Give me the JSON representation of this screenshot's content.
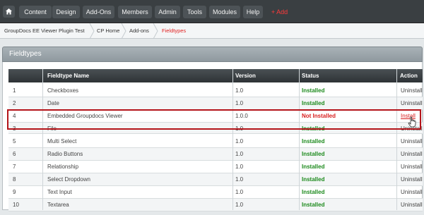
{
  "nav": {
    "items": [
      "Content",
      "Design",
      "Add-Ons",
      "Members",
      "Admin",
      "Tools",
      "Modules",
      "Help"
    ],
    "add_label": "+ Add"
  },
  "breadcrumb": [
    "GroupDocs EE Viewer Plugin Test",
    "CP Home",
    "Add-ons",
    "Fieldtypes"
  ],
  "panel": {
    "title": "Fieldtypes"
  },
  "table": {
    "headers": [
      "Fieldtype Name",
      "Version",
      "Status",
      "Action"
    ],
    "rows": [
      {
        "num": "1",
        "name": "Checkboxes",
        "version": "1.0",
        "status": "Installed",
        "action": "Uninstall"
      },
      {
        "num": "2",
        "name": "Date",
        "version": "1.0",
        "status": "Installed",
        "action": "Uninstall"
      },
      {
        "num": "4",
        "name": "Embedded Groupdocs Viewer",
        "version": "1.0.0",
        "status": "Not Installed",
        "action": "Install"
      },
      {
        "num": "3",
        "name": "File",
        "version": "1.0",
        "status": "Installed",
        "action": "Uninstall"
      },
      {
        "num": "5",
        "name": "Multi Select",
        "version": "1.0",
        "status": "Installed",
        "action": "Uninstall"
      },
      {
        "num": "6",
        "name": "Radio Buttons",
        "version": "1.0",
        "status": "Installed",
        "action": "Uninstall"
      },
      {
        "num": "7",
        "name": "Relationship",
        "version": "1.0",
        "status": "Installed",
        "action": "Uninstall"
      },
      {
        "num": "8",
        "name": "Select Dropdown",
        "version": "1.0",
        "status": "Installed",
        "action": "Uninstall"
      },
      {
        "num": "9",
        "name": "Text Input",
        "version": "1.0",
        "status": "Installed",
        "action": "Uninstall"
      },
      {
        "num": "10",
        "name": "Textarea",
        "version": "1.0",
        "status": "Installed",
        "action": "Uninstall"
      }
    ]
  },
  "colors": {
    "installed": "#1d8a1d",
    "not_installed": "#d81e1e",
    "highlight": "#b4141a"
  }
}
